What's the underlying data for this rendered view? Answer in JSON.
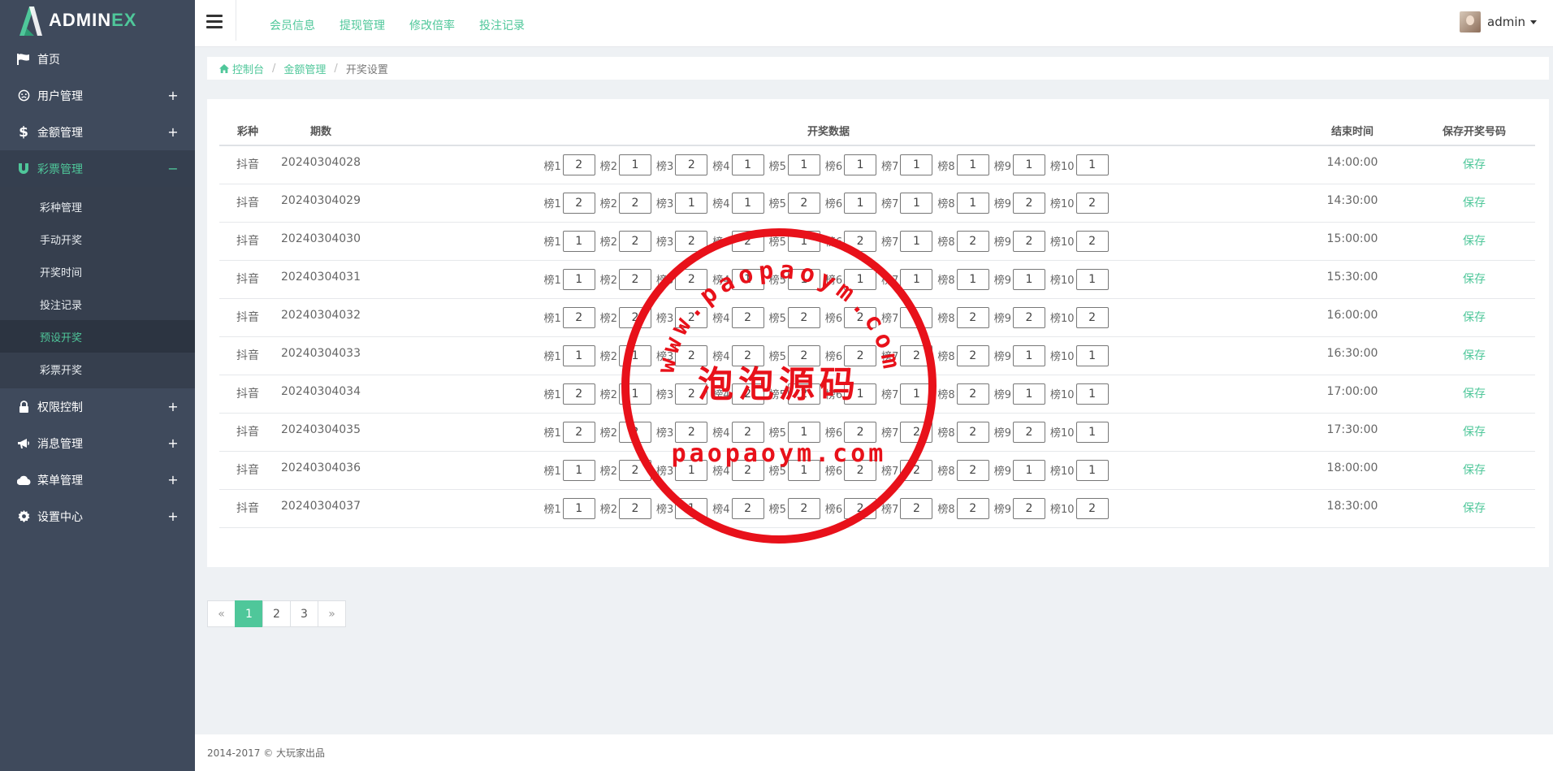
{
  "brand": {
    "name_main": "ADMIN",
    "name_accent": "EX"
  },
  "sidebar": {
    "items": [
      {
        "label": "首页",
        "icon": "flag-icon",
        "toggle": ""
      },
      {
        "label": "用户管理",
        "icon": "user-circle-icon",
        "toggle": "+"
      },
      {
        "label": "金额管理",
        "icon": "dollar-icon",
        "toggle": "+"
      },
      {
        "label": "彩票管理",
        "icon": "magnet-icon",
        "toggle": "−"
      },
      {
        "label": "权限控制",
        "icon": "lock-icon",
        "toggle": "+"
      },
      {
        "label": "消息管理",
        "icon": "bullhorn-icon",
        "toggle": "+"
      },
      {
        "label": "菜单管理",
        "icon": "cloud-icon",
        "toggle": "+"
      },
      {
        "label": "设置中心",
        "icon": "gear-icon",
        "toggle": "+"
      }
    ],
    "sub_items": [
      "彩种管理",
      "手动开奖",
      "开奖时间",
      "投注记录",
      "预设开奖",
      "彩票开奖"
    ]
  },
  "topbar": {
    "links": [
      "会员信息",
      "提现管理",
      "修改倍率",
      "投注记录"
    ],
    "user": "admin"
  },
  "breadcrumb": {
    "home": "控制台",
    "parent": "金额管理",
    "current": "开奖设置"
  },
  "table": {
    "headers": {
      "kind": "彩种",
      "period": "期数",
      "draw": "开奖数据",
      "end_time": "结束时间",
      "save": "保存开奖号码"
    },
    "slot_labels": [
      "榜1",
      "榜2",
      "榜3",
      "榜4",
      "榜5",
      "榜6",
      "榜7",
      "榜8",
      "榜9",
      "榜10"
    ],
    "rows": [
      {
        "kind": "抖音",
        "period": "20240304028",
        "values": [
          "2",
          "1",
          "2",
          "1",
          "1",
          "1",
          "1",
          "1",
          "1",
          "1"
        ],
        "end_time": "14:00:00",
        "action": "保存"
      },
      {
        "kind": "抖音",
        "period": "20240304029",
        "values": [
          "2",
          "2",
          "1",
          "1",
          "2",
          "1",
          "1",
          "1",
          "2",
          "2"
        ],
        "end_time": "14:30:00",
        "action": "保存"
      },
      {
        "kind": "抖音",
        "period": "20240304030",
        "values": [
          "1",
          "2",
          "2",
          "2",
          "1",
          "2",
          "1",
          "2",
          "2",
          "2"
        ],
        "end_time": "15:00:00",
        "action": "保存"
      },
      {
        "kind": "抖音",
        "period": "20240304031",
        "values": [
          "1",
          "2",
          "2",
          "1",
          "1",
          "1",
          "1",
          "1",
          "1",
          "1"
        ],
        "end_time": "15:30:00",
        "action": "保存"
      },
      {
        "kind": "抖音",
        "period": "20240304032",
        "values": [
          "2",
          "2",
          "2",
          "2",
          "2",
          "2",
          "1",
          "2",
          "2",
          "2"
        ],
        "end_time": "16:00:00",
        "action": "保存"
      },
      {
        "kind": "抖音",
        "period": "20240304033",
        "values": [
          "1",
          "1",
          "2",
          "2",
          "2",
          "2",
          "2",
          "2",
          "1",
          "1"
        ],
        "end_time": "16:30:00",
        "action": "保存"
      },
      {
        "kind": "抖音",
        "period": "20240304034",
        "values": [
          "2",
          "1",
          "2",
          "2",
          "2",
          "1",
          "1",
          "2",
          "1",
          "1"
        ],
        "end_time": "17:00:00",
        "action": "保存"
      },
      {
        "kind": "抖音",
        "period": "20240304035",
        "values": [
          "2",
          "2",
          "2",
          "2",
          "1",
          "2",
          "2",
          "2",
          "2",
          "1"
        ],
        "end_time": "17:30:00",
        "action": "保存"
      },
      {
        "kind": "抖音",
        "period": "20240304036",
        "values": [
          "1",
          "2",
          "1",
          "2",
          "1",
          "2",
          "2",
          "2",
          "1",
          "1"
        ],
        "end_time": "18:00:00",
        "action": "保存"
      },
      {
        "kind": "抖音",
        "period": "20240304037",
        "values": [
          "1",
          "2",
          "1",
          "2",
          "2",
          "2",
          "2",
          "2",
          "2",
          "2"
        ],
        "end_time": "18:30:00",
        "action": "保存"
      }
    ]
  },
  "pagination": {
    "prev": "«",
    "pages": [
      "1",
      "2",
      "3"
    ],
    "next": "»",
    "current": "1"
  },
  "footer": {
    "text": "2014-2017 © 大玩家出品"
  },
  "watermark": {
    "url_arc": "www.paopaoym.com",
    "title": "泡泡源码",
    "domain": "paopaoym.com",
    "color": "#e8111a"
  },
  "colors": {
    "accent": "#4fc79a",
    "sidebar_bg": "#3f4a5c"
  }
}
